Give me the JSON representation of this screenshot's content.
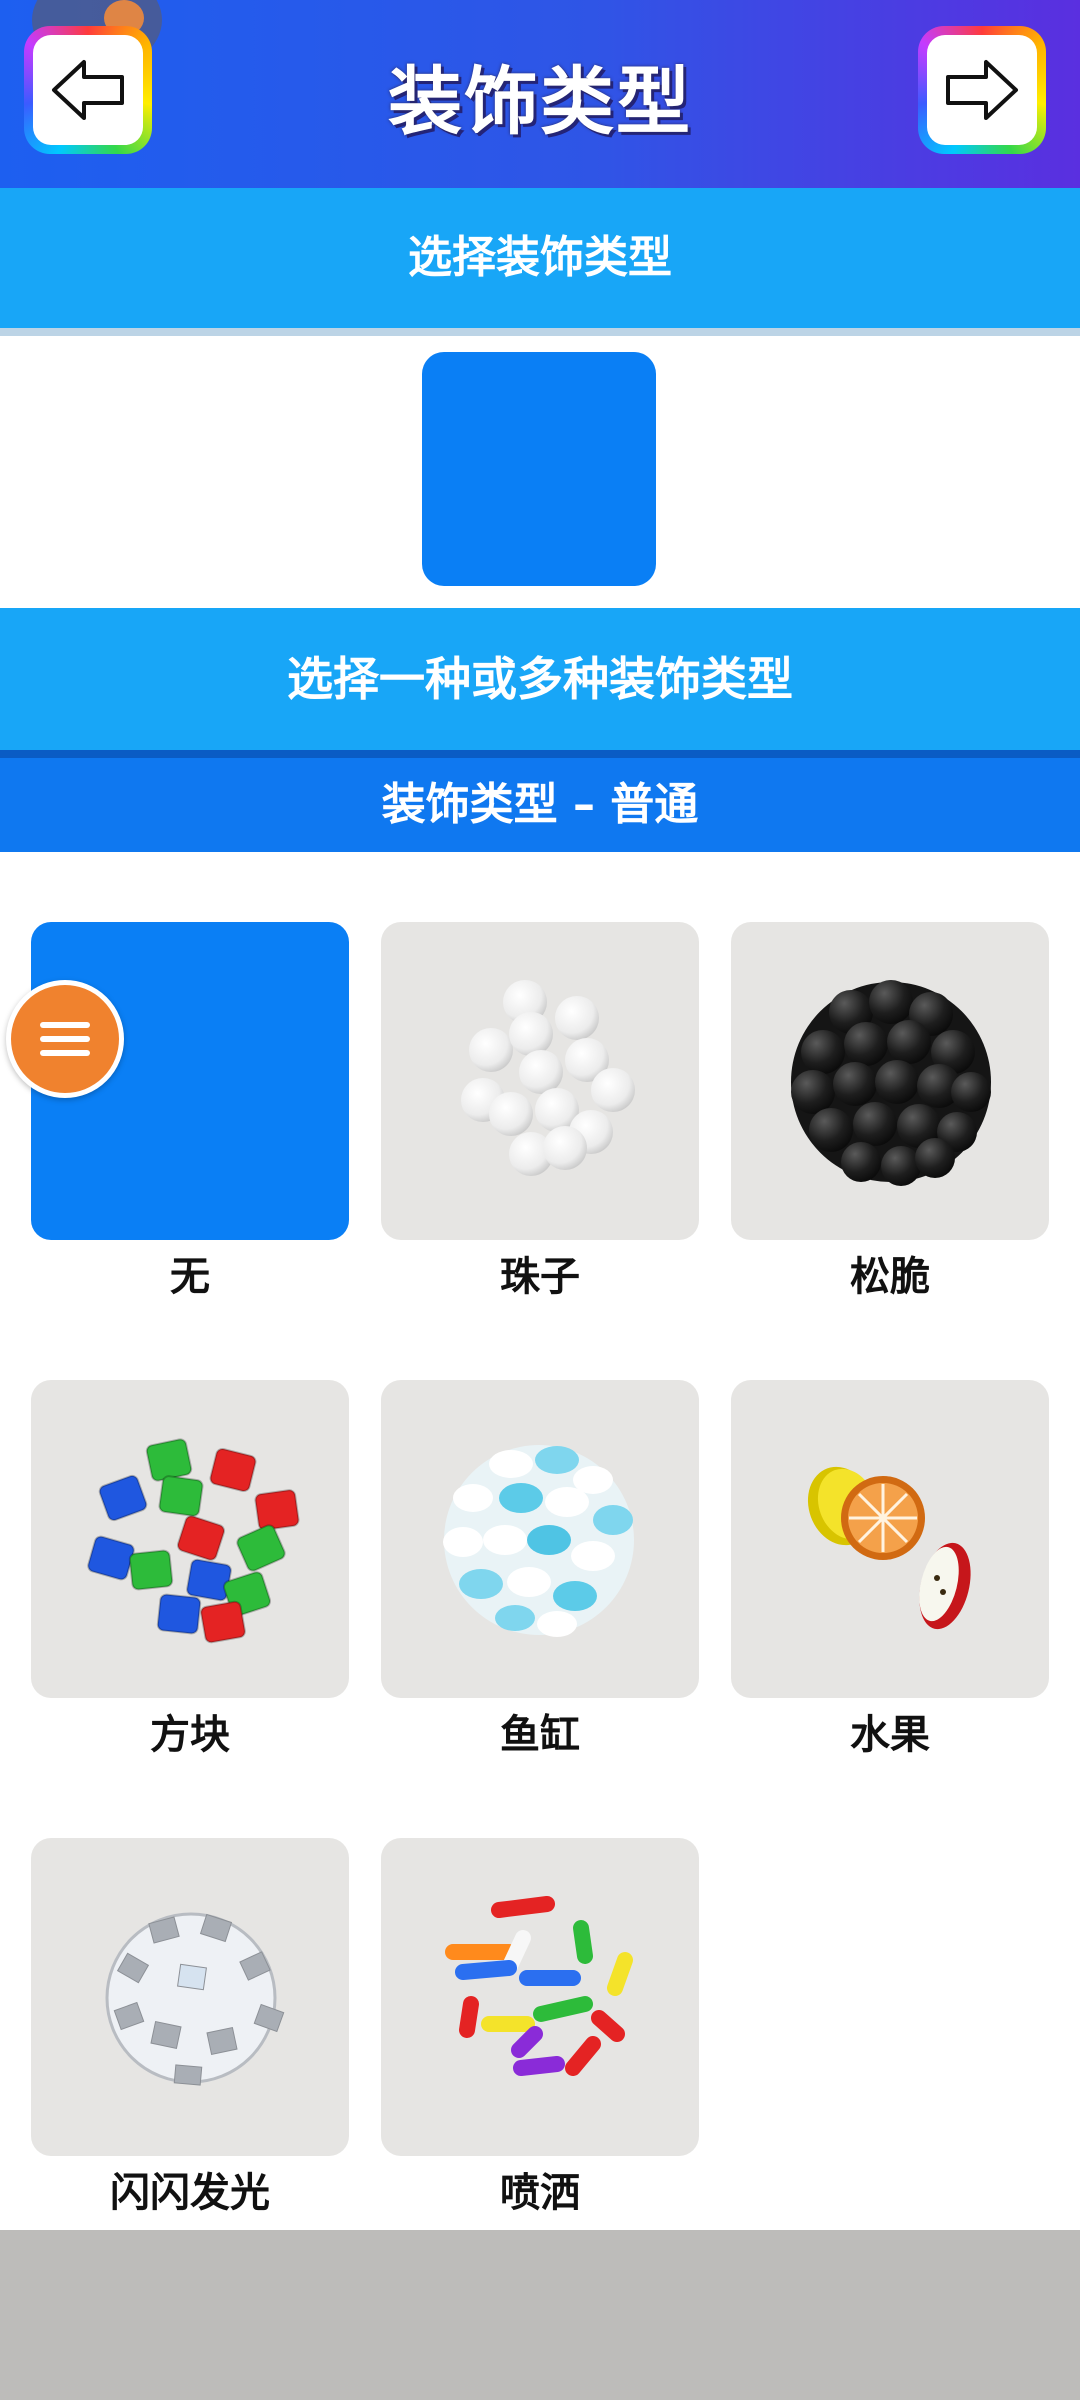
{
  "header": {
    "title": "装饰类型",
    "back_icon": "arrow-left-icon",
    "next_icon": "arrow-right-icon",
    "gradient_colors": [
      "#1d5ff0",
      "#5a2fe0"
    ]
  },
  "section_select": {
    "label": "选择装饰类型"
  },
  "preview": {
    "swatch_color": "#0a7ff5"
  },
  "section_multi": {
    "label": "选择一种或多种装饰类型"
  },
  "category": {
    "label": "装饰类型 – 普通"
  },
  "menu_button": {
    "icon": "hamburger-icon",
    "color": "#f0822e"
  },
  "options": [
    {
      "label": "无",
      "selected": true
    },
    {
      "label": "珠子",
      "selected": false
    },
    {
      "label": "松脆",
      "selected": false
    },
    {
      "label": "方块",
      "selected": false
    },
    {
      "label": "鱼缸",
      "selected": false
    },
    {
      "label": "水果",
      "selected": false
    },
    {
      "label": "闪闪发光",
      "selected": false
    },
    {
      "label": "喷洒",
      "selected": false
    }
  ]
}
